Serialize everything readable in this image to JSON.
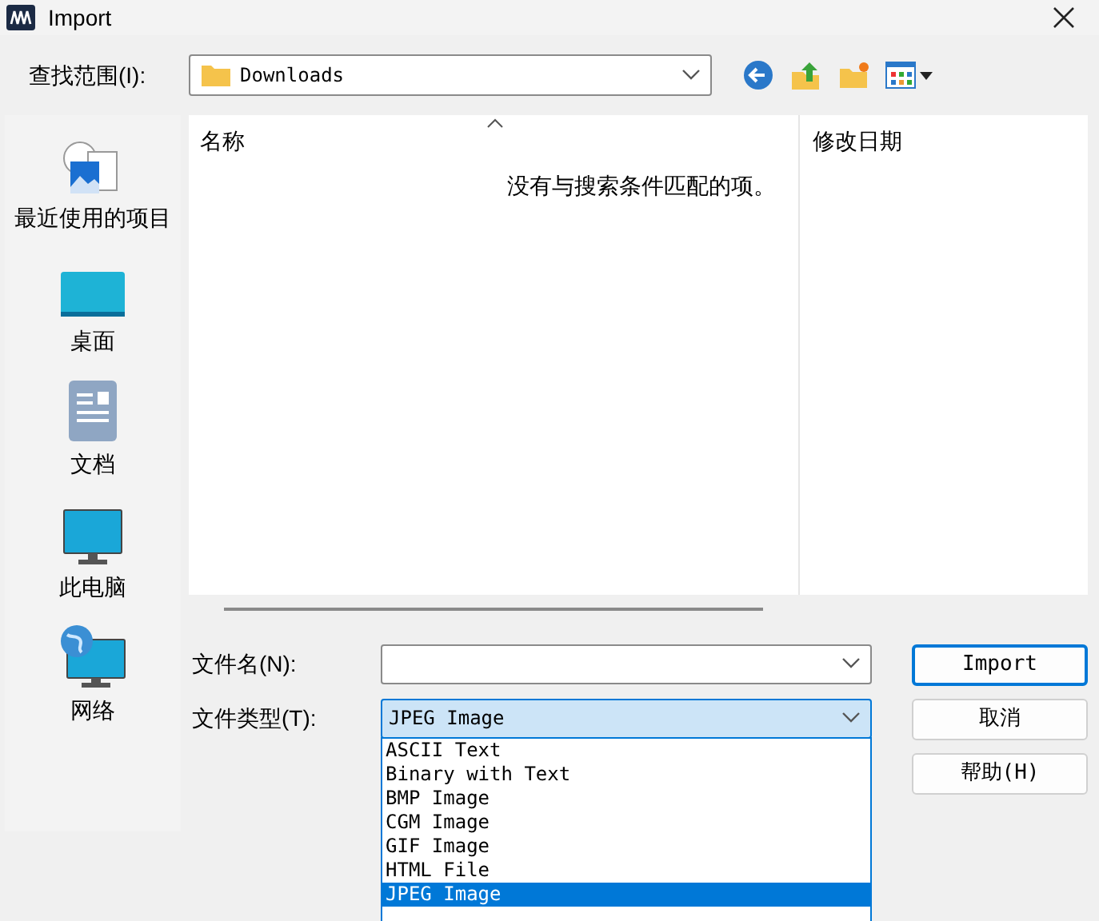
{
  "window": {
    "title": "Import"
  },
  "look_in": {
    "label": "查找范围(I):",
    "value": "Downloads"
  },
  "places": [
    {
      "label": "最近使用的项目",
      "kind": "recent"
    },
    {
      "label": "桌面",
      "kind": "desktop"
    },
    {
      "label": "文档",
      "kind": "documents"
    },
    {
      "label": "此电脑",
      "kind": "computer"
    },
    {
      "label": "网络",
      "kind": "network"
    }
  ],
  "file_list": {
    "columns": [
      "名称",
      "修改日期"
    ],
    "empty_message": "没有与搜索条件匹配的项。"
  },
  "file_name": {
    "label": "文件名(N):"
  },
  "file_type": {
    "label": "文件类型(T):",
    "value": "JPEG Image",
    "expanded": true,
    "options": [
      {
        "label": "ASCII Text",
        "selected": false
      },
      {
        "label": "Binary with Text",
        "selected": false
      },
      {
        "label": "BMP Image",
        "selected": false
      },
      {
        "label": "CGM Image",
        "selected": false
      },
      {
        "label": "GIF Image",
        "selected": false
      },
      {
        "label": "HTML File",
        "selected": false
      },
      {
        "label": "JPEG Image",
        "selected": true
      }
    ]
  },
  "buttons": [
    {
      "label": "Import",
      "default": true
    },
    {
      "label": "取消",
      "default": false
    },
    {
      "label": "帮助(H)",
      "default": false
    }
  ]
}
